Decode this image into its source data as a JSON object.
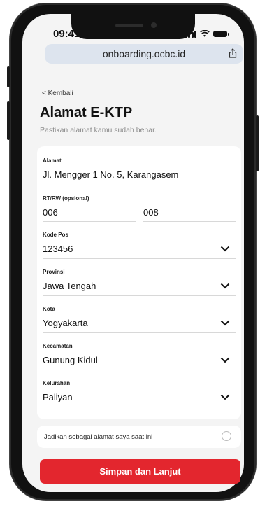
{
  "status": {
    "time": "09:41"
  },
  "browser": {
    "url": "onboarding.ocbc.id"
  },
  "nav": {
    "back_label": "< Kembali"
  },
  "page": {
    "title": "Alamat E-KTP",
    "subtitle": "Pastikan alamat kamu sudah benar."
  },
  "form": {
    "alamat": {
      "label": "Alamat",
      "value": "Jl. Mengger 1 No. 5, Karangasem"
    },
    "rtrw": {
      "label": "RT/RW (opsional)",
      "rt": "006",
      "rw": "008"
    },
    "kode_pos": {
      "label": "Kode Pos",
      "value": "123456"
    },
    "provinsi": {
      "label": "Provinsi",
      "value": "Jawa Tengah"
    },
    "kota": {
      "label": "Kota",
      "value": "Yogyakarta"
    },
    "kecamatan": {
      "label": "Kecamatan",
      "value": "Gunung Kidul"
    },
    "kelurahan": {
      "label": "Kelurahan",
      "value": "Paliyan"
    }
  },
  "toggle": {
    "label": "Jadikan sebagai alamat saya saat ini",
    "checked": false
  },
  "cta": {
    "label": "Simpan dan Lanjut",
    "color": "#e3262e"
  },
  "icons": {
    "dropdown": "chevron-down-icon",
    "share": "share-icon",
    "signal": "signal-icon",
    "wifi": "wifi-icon",
    "battery": "battery-icon"
  }
}
